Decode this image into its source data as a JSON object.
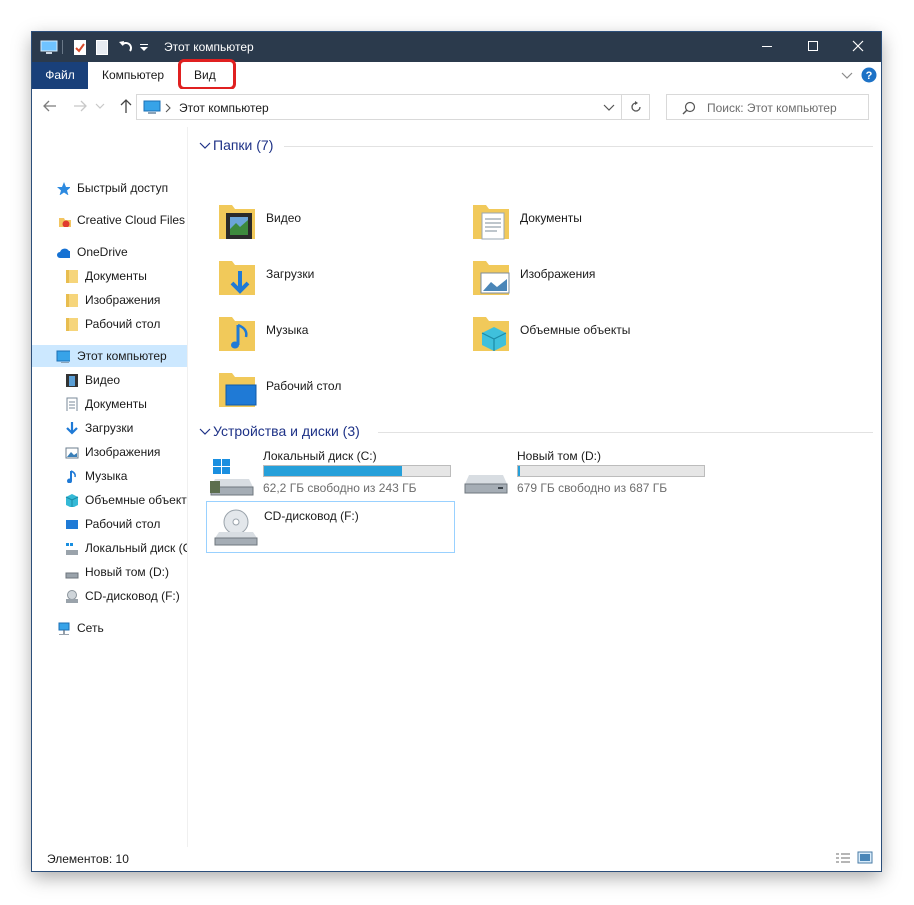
{
  "window": {
    "title": "Этот компьютер"
  },
  "ribbon": {
    "tabs": [
      {
        "label": "Файл"
      },
      {
        "label": "Компьютер"
      },
      {
        "label": "Вид"
      }
    ]
  },
  "address": {
    "path": "Этот компьютер"
  },
  "search": {
    "placeholder": "Поиск: Этот компьютер"
  },
  "sidebar": {
    "items": [
      {
        "label": "Быстрый доступ",
        "icon": "star-icon"
      },
      {
        "label": "Creative Cloud Files",
        "icon": "creative-cloud-icon"
      },
      {
        "label": "OneDrive",
        "icon": "cloud-icon"
      },
      {
        "label": "Документы",
        "icon": "folder-icon"
      },
      {
        "label": "Изображения",
        "icon": "folder-icon"
      },
      {
        "label": "Рабочий стол",
        "icon": "folder-icon"
      },
      {
        "label": "Этот компьютер",
        "icon": "computer-icon"
      },
      {
        "label": "Видео",
        "icon": "video-icon"
      },
      {
        "label": "Документы",
        "icon": "document-icon"
      },
      {
        "label": "Загрузки",
        "icon": "download-icon"
      },
      {
        "label": "Изображения",
        "icon": "pictures-icon"
      },
      {
        "label": "Музыка",
        "icon": "music-icon"
      },
      {
        "label": "Объемные объект",
        "icon": "3d-objects-icon"
      },
      {
        "label": "Рабочий стол",
        "icon": "desktop-icon"
      },
      {
        "label": "Локальный диск (С",
        "icon": "local-disk-icon"
      },
      {
        "label": "Новый том (D:)",
        "icon": "drive-icon"
      },
      {
        "label": "CD-дисковод (F:)",
        "icon": "cd-drive-icon"
      },
      {
        "label": "Сеть",
        "icon": "network-icon"
      }
    ]
  },
  "folders": {
    "header": "Папки (7)",
    "items": [
      {
        "label": "Видео",
        "icon": "video-folder-icon"
      },
      {
        "label": "Документы",
        "icon": "documents-folder-icon"
      },
      {
        "label": "Загрузки",
        "icon": "downloads-folder-icon"
      },
      {
        "label": "Изображения",
        "icon": "pictures-folder-icon"
      },
      {
        "label": "Музыка",
        "icon": "music-folder-icon"
      },
      {
        "label": "Объемные объекты",
        "icon": "3d-objects-folder-icon"
      },
      {
        "label": "Рабочий стол",
        "icon": "desktop-folder-icon"
      }
    ]
  },
  "devices": {
    "header": "Устройства и диски (3)",
    "items": [
      {
        "name": "Локальный диск (C:)",
        "free": "62,2 ГБ свободно из 243 ГБ",
        "used_fraction": 0.744,
        "icon": "windows-disk-icon"
      },
      {
        "name": "Новый том (D:)",
        "free": "679 ГБ свободно из 687 ГБ",
        "used_fraction": 0.012,
        "icon": "hard-drive-icon"
      },
      {
        "name": "CD-дисковод (F:)",
        "icon": "cd-drive-icon"
      }
    ]
  },
  "status": {
    "items_count": "Элементов: 10"
  },
  "colors": {
    "titlebar": "#2b3a4c",
    "file_tab": "#19407a",
    "accent": "#26a0da",
    "group_header": "#1e3287",
    "highlight_box": "#e02020",
    "selected": "#cce8ff"
  }
}
